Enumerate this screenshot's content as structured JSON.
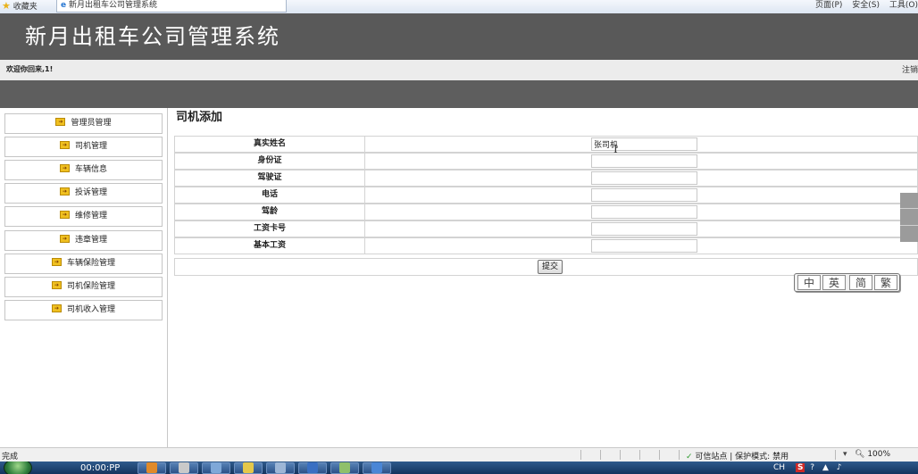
{
  "browser": {
    "favorites_label": "收藏夹",
    "tab_title": "新月出租车公司管理系统",
    "menus": [
      "页面(P)",
      "安全(S)",
      "工具(O)"
    ]
  },
  "app": {
    "title": "新月出租车公司管理系统",
    "welcome": "欢迎你回来,1!",
    "logout": "注销"
  },
  "sidebar": {
    "items": [
      {
        "label": "管理员管理"
      },
      {
        "label": "司机管理"
      },
      {
        "label": "车辆信息"
      },
      {
        "label": "投诉管理"
      },
      {
        "label": "维修管理"
      },
      {
        "label": "违章管理"
      },
      {
        "label": "车辆保险管理"
      },
      {
        "label": "司机保险管理"
      },
      {
        "label": "司机收入管理"
      }
    ]
  },
  "main": {
    "heading": "司机添加",
    "fields": [
      {
        "label": "真实姓名",
        "value": "张司机",
        "placeholder": ""
      },
      {
        "label": "身份证",
        "value": "",
        "placeholder": ""
      },
      {
        "label": "驾驶证",
        "value": "",
        "placeholder": ""
      },
      {
        "label": "电话",
        "value": "",
        "placeholder": ""
      },
      {
        "label": "驾龄",
        "value": "",
        "placeholder": ""
      },
      {
        "label": "工资卡号",
        "value": "",
        "placeholder": ""
      },
      {
        "label": "基本工资",
        "value": "",
        "placeholder": ""
      }
    ],
    "submit_label": "提交"
  },
  "language_switch": [
    "中",
    "英",
    "简",
    "繁"
  ],
  "status_bar": {
    "status": "完成",
    "zone": "可信站点 | 保护模式: 禁用",
    "zoom": "100%"
  },
  "taskbar": {
    "time": "00:00:PP",
    "ime": "CH"
  },
  "colors": {
    "header_bg": "#595959",
    "welcome_bg": "#ececec",
    "band_bg": "#5e5e5e",
    "menu_icon": "#f0c020"
  },
  "icons": {
    "favorites": "star-icon",
    "tab": "ie-icon",
    "menu": "arrow-right-icon",
    "zone": "check-icon",
    "zoom": "magnifier-icon"
  }
}
